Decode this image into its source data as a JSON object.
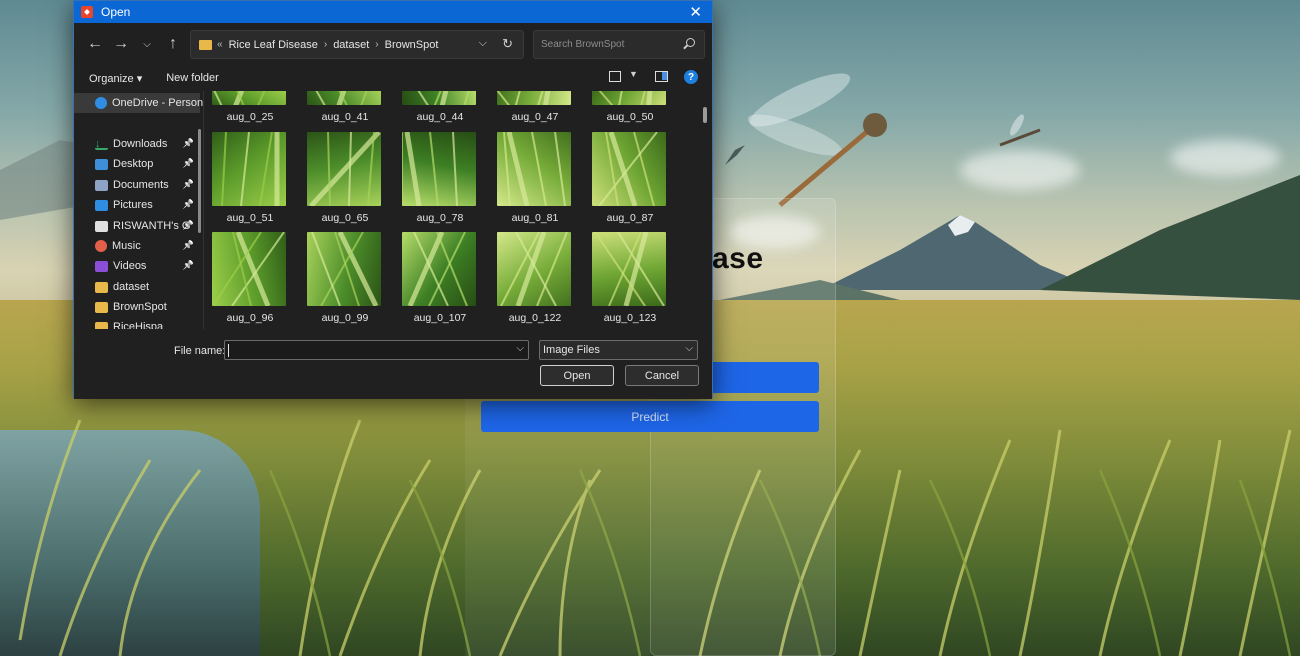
{
  "dialog": {
    "title": "Open",
    "address": [
      "Rice Leaf Disease",
      "dataset",
      "BrownSpot"
    ],
    "address_prefix": "«",
    "search_placeholder": "Search BrownSpot",
    "toolbar": {
      "organize": "Organize ▾",
      "new_folder": "New folder"
    },
    "sidebar": [
      {
        "label": "OneDrive - Person",
        "icon": "onedrive-icon",
        "color": "#2f8de4",
        "pinned": false
      },
      {
        "label": "Downloads",
        "icon": "downloads-icon",
        "color": "#39a96b",
        "pinned": true
      },
      {
        "label": "Desktop",
        "icon": "desktop-icon",
        "color": "#3f8fd8",
        "pinned": true
      },
      {
        "label": "Documents",
        "icon": "documents-icon",
        "color": "#8ea4c6",
        "pinned": true
      },
      {
        "label": "Pictures",
        "icon": "pictures-icon",
        "color": "#2f8de4",
        "pinned": true
      },
      {
        "label": "RISWANTH's G",
        "icon": "file-icon",
        "color": "#e0e0e0",
        "pinned": true
      },
      {
        "label": "Music",
        "icon": "music-icon",
        "color": "#e2604a",
        "pinned": true
      },
      {
        "label": "Videos",
        "icon": "videos-icon",
        "color": "#8a4fd6",
        "pinned": true
      },
      {
        "label": "dataset",
        "icon": "folder-icon",
        "color": "#e8b84a",
        "pinned": false
      },
      {
        "label": "BrownSpot",
        "icon": "folder-icon",
        "color": "#e8b84a",
        "pinned": false
      },
      {
        "label": "RiceHispa",
        "icon": "folder-icon",
        "color": "#e8b84a",
        "pinned": false
      }
    ],
    "files": [
      "aug_0_25",
      "aug_0_41",
      "aug_0_44",
      "aug_0_47",
      "aug_0_50",
      "aug_0_51",
      "aug_0_65",
      "aug_0_78",
      "aug_0_81",
      "aug_0_87",
      "aug_0_96",
      "aug_0_99",
      "aug_0_107",
      "aug_0_122",
      "aug_0_123"
    ],
    "file_name_label": "File name:",
    "file_name_value": "",
    "file_type": "Image Files",
    "open_label": "Open",
    "cancel_label": "Cancel"
  },
  "app": {
    "title_fragment": "ase",
    "predict_label": "Predict",
    "accent": "#1e66e8"
  }
}
